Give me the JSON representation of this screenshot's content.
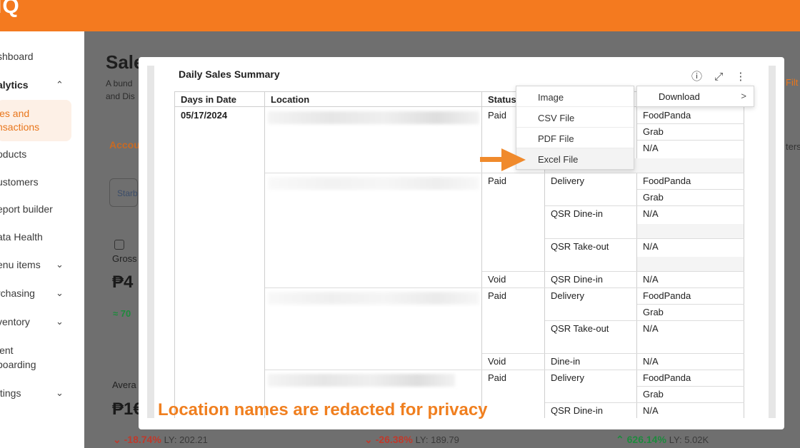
{
  "brand": "IQ",
  "sidebar": {
    "items": [
      {
        "label": "shboard"
      },
      {
        "label": "alytics"
      },
      {
        "label": "oducts"
      },
      {
        "label": "ustomers"
      },
      {
        "label": "eport builder"
      },
      {
        "label": "ata Health"
      },
      {
        "label": "enu items"
      },
      {
        "label": "rchasing"
      },
      {
        "label": "ventory"
      },
      {
        "label": "ient"
      },
      {
        "label": "boarding"
      },
      {
        "label": "ttings"
      }
    ],
    "active_line1": "les and",
    "active_line2": "nsactions"
  },
  "background": {
    "title": "Sale",
    "subtitle": "A bund and Dis",
    "tab": "Accou",
    "select": "Starb",
    "gross_label": "Gross",
    "gross_value": "₱4",
    "gross_delta": "≈ 70",
    "avg_label": "Avera",
    "avg_value": "₱1€",
    "stat1_delta": "-18.74%",
    "stat1_ly": "LY: 202.21",
    "stat2_delta": "-26.38%",
    "stat2_ly": "LY: 189.79",
    "stat3_delta": "626.14%",
    "stat3_ly": "LY: 5.02K",
    "right_filter": "Filt",
    "right_ters": "ters"
  },
  "card": {
    "title": "Daily Sales Summary",
    "icons": [
      "info-icon",
      "expand-icon",
      "more-vertical-icon"
    ]
  },
  "table": {
    "headers": [
      "Days in Date",
      "Location",
      "Status",
      "",
      ""
    ],
    "date": "05/17/2024",
    "rows": [
      {
        "status": "Paid",
        "type": "",
        "channel": "FoodPanda"
      },
      {
        "status": "",
        "type": "",
        "channel": "Grab"
      },
      {
        "status": "",
        "type": "",
        "channel": "N/A"
      },
      {
        "status": "Paid",
        "type": "Delivery",
        "channel": "FoodPanda"
      },
      {
        "status": "",
        "type": "",
        "channel": "Grab"
      },
      {
        "status": "",
        "type": "QSR Dine-in",
        "channel": "N/A"
      },
      {
        "status": "",
        "type": "QSR Take-out",
        "channel": "N/A"
      },
      {
        "status": "Void",
        "type": "QSR Dine-in",
        "channel": "N/A"
      },
      {
        "status": "Paid",
        "type": "Delivery",
        "channel": "FoodPanda"
      },
      {
        "status": "",
        "type": "",
        "channel": "Grab"
      },
      {
        "status": "",
        "type": "QSR Take-out",
        "channel": "N/A"
      },
      {
        "status": "Void",
        "type": "Dine-in",
        "channel": "N/A"
      },
      {
        "status": "Paid",
        "type": "Delivery",
        "channel": "FoodPanda"
      },
      {
        "status": "",
        "type": "",
        "channel": "Grab"
      },
      {
        "status": "",
        "type": "QSR Dine-in",
        "channel": "N/A"
      }
    ]
  },
  "menu": {
    "items": [
      "Image",
      "CSV File",
      "PDF File",
      "Excel File"
    ],
    "submenu_label": "Download",
    "submenu_chevron": ">"
  },
  "annotation": {
    "caption": "Location names are redacted for privacy"
  },
  "colors": {
    "brand_orange": "#f47a1f",
    "annotation_orange": "#f08a2c",
    "positive": "#1e8a3d",
    "negative": "#c0392b"
  }
}
